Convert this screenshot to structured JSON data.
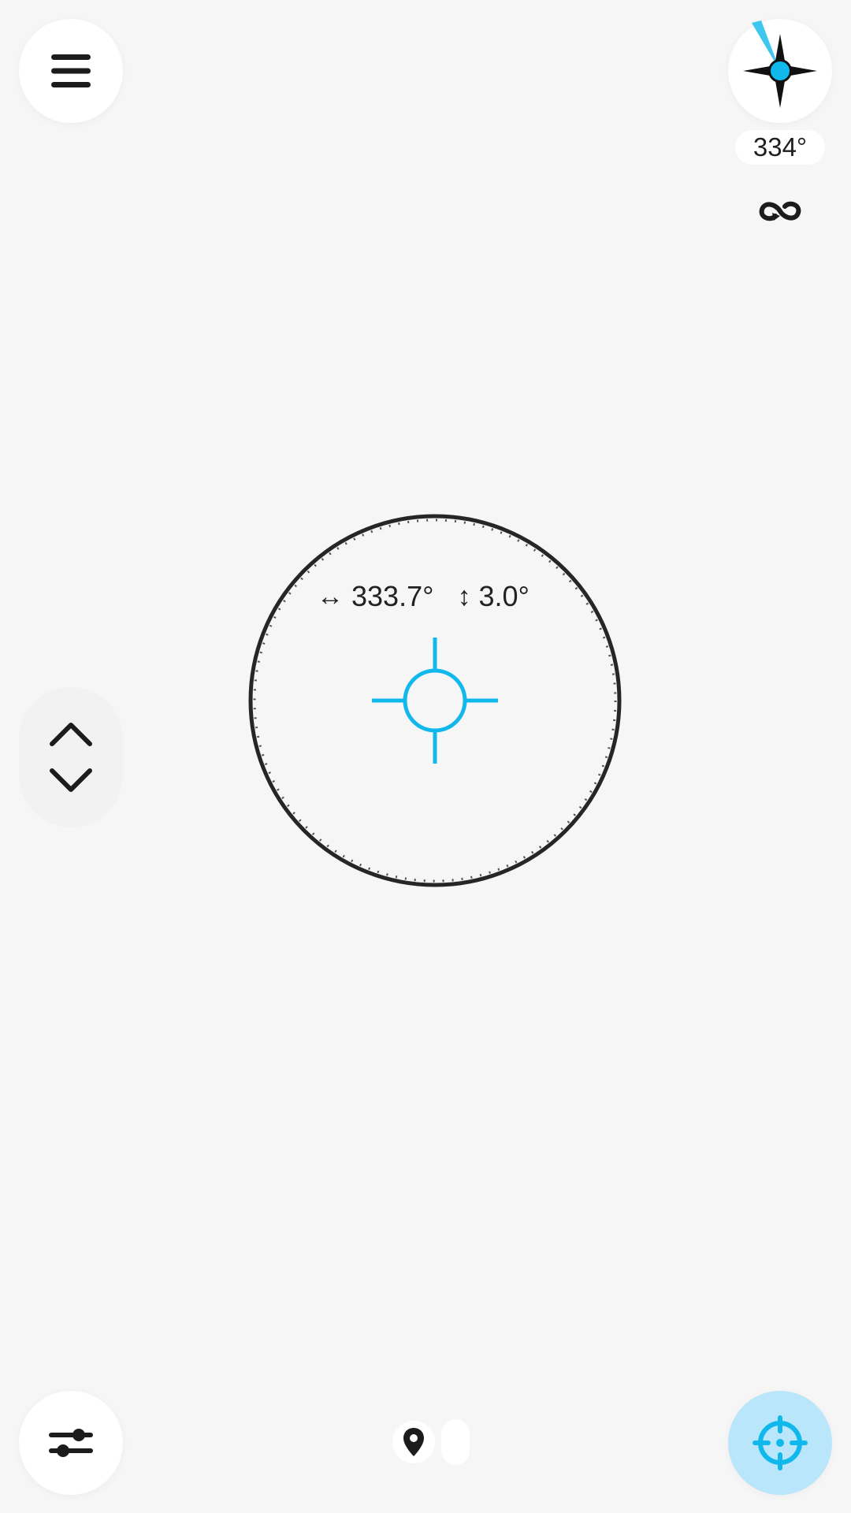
{
  "header": {
    "menu_icon": "hamburger-menu-icon",
    "compass_icon": "compass-rose-icon",
    "heading_value": "334°",
    "link_icon": "infinity-link-icon"
  },
  "level_controls": {
    "up_icon": "chevron-up-icon",
    "down_icon": "chevron-down-icon"
  },
  "scope": {
    "horizontal_symbol": "↔",
    "horizontal_value": "333.7°",
    "vertical_symbol": "↕",
    "vertical_value": "3.0°",
    "crosshair_icon": "crosshair-icon"
  },
  "footer": {
    "settings_icon": "sliders-icon",
    "pin_icon": "map-pin-icon",
    "locate_icon": "target-locate-icon"
  },
  "colors": {
    "background": "#f6f6f6",
    "accent": "#11b8ec",
    "accent_light": "#b9e6fa",
    "ink": "#1c1c1c"
  }
}
